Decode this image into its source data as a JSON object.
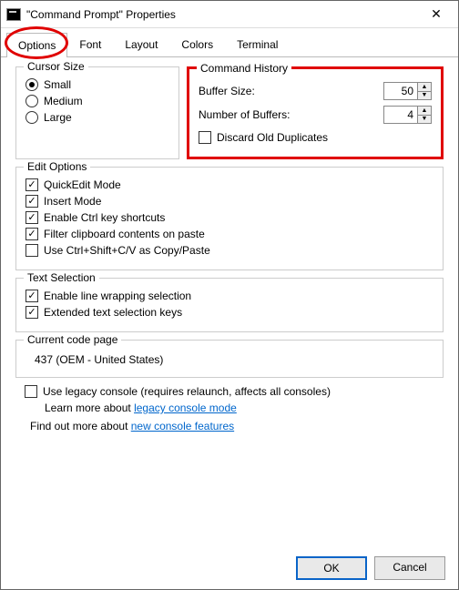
{
  "window": {
    "title": "\"Command Prompt\" Properties",
    "close_glyph": "✕"
  },
  "tabs": {
    "options": "Options",
    "font": "Font",
    "layout": "Layout",
    "colors": "Colors",
    "terminal": "Terminal"
  },
  "cursor": {
    "legend": "Cursor Size",
    "small": "Small",
    "medium": "Medium",
    "large": "Large"
  },
  "history": {
    "legend": "Command History",
    "buffer_size_label": "Buffer Size:",
    "buffer_size_value": "50",
    "num_buffers_label": "Number of Buffers:",
    "num_buffers_value": "4",
    "discard_label": "Discard Old Duplicates"
  },
  "edit": {
    "legend": "Edit Options",
    "quickedit": "QuickEdit Mode",
    "insert": "Insert Mode",
    "ctrl": "Enable Ctrl key shortcuts",
    "filter": "Filter clipboard contents on paste",
    "ctrlshift": "Use Ctrl+Shift+C/V as Copy/Paste"
  },
  "textsel": {
    "legend": "Text Selection",
    "linewrap": "Enable line wrapping selection",
    "extended": "Extended text selection keys"
  },
  "codepage": {
    "legend": "Current code page",
    "value": "437   (OEM - United States)"
  },
  "legacy": {
    "use_label": "Use legacy console (requires relaunch, affects all consoles)",
    "learn_prefix": "Learn more about ",
    "learn_link": "legacy console mode"
  },
  "findout": {
    "prefix": "Find out more about ",
    "link": "new console features"
  },
  "buttons": {
    "ok": "OK",
    "cancel": "Cancel"
  }
}
